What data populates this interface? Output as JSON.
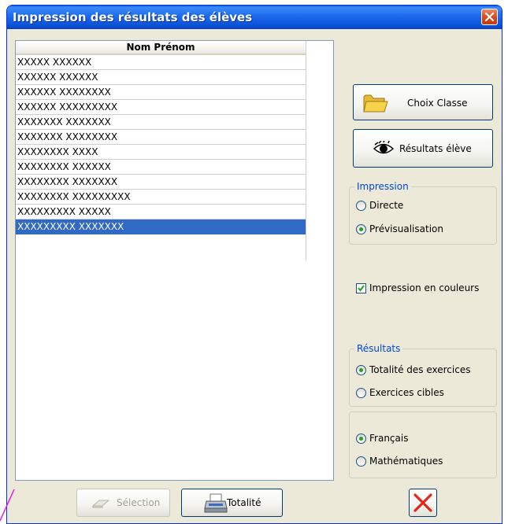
{
  "window": {
    "title": "Impression des résultats des élèves"
  },
  "list": {
    "header": "Nom Prénom",
    "rows": [
      "XXXXX XXXXXX",
      "XXXXXX XXXXXX",
      "XXXXXX XXXXXXXX",
      "XXXXXX XXXXXXXXX",
      "XXXXXXX XXXXXXX",
      "XXXXXXX XXXXXXXX",
      "XXXXXXXX XXXX",
      "XXXXXXXX XXXXXX",
      "XXXXXXXX XXXXXXX",
      "XXXXXXXX XXXXXXXXX",
      "XXXXXXXXX XXXXX",
      "XXXXXXXXX XXXXXXX"
    ],
    "selected_index": 11
  },
  "buttons": {
    "choix_classe": "Choix Classe",
    "resultats_eleve": "Résultats élève",
    "selection": "Sélection",
    "totalite": "Totalité"
  },
  "impression": {
    "title": "Impression",
    "directe": "Directe",
    "previsualisation": "Prévisualisation",
    "selected": "previsualisation"
  },
  "couleurs": {
    "label": "Impression en couleurs",
    "checked": true
  },
  "resultats": {
    "title": "Résultats",
    "totalite": "Totalité des exercices",
    "cibles": "Exercices cibles",
    "selected": "totalite"
  },
  "matiere": {
    "francais": "Français",
    "mathematiques": "Mathématiques",
    "selected": "francais"
  },
  "colors": {
    "titlebar": "#0a5ce6",
    "selection": "#316ac5",
    "group_title": "#0046d5",
    "close_red": "#d84a1c"
  }
}
